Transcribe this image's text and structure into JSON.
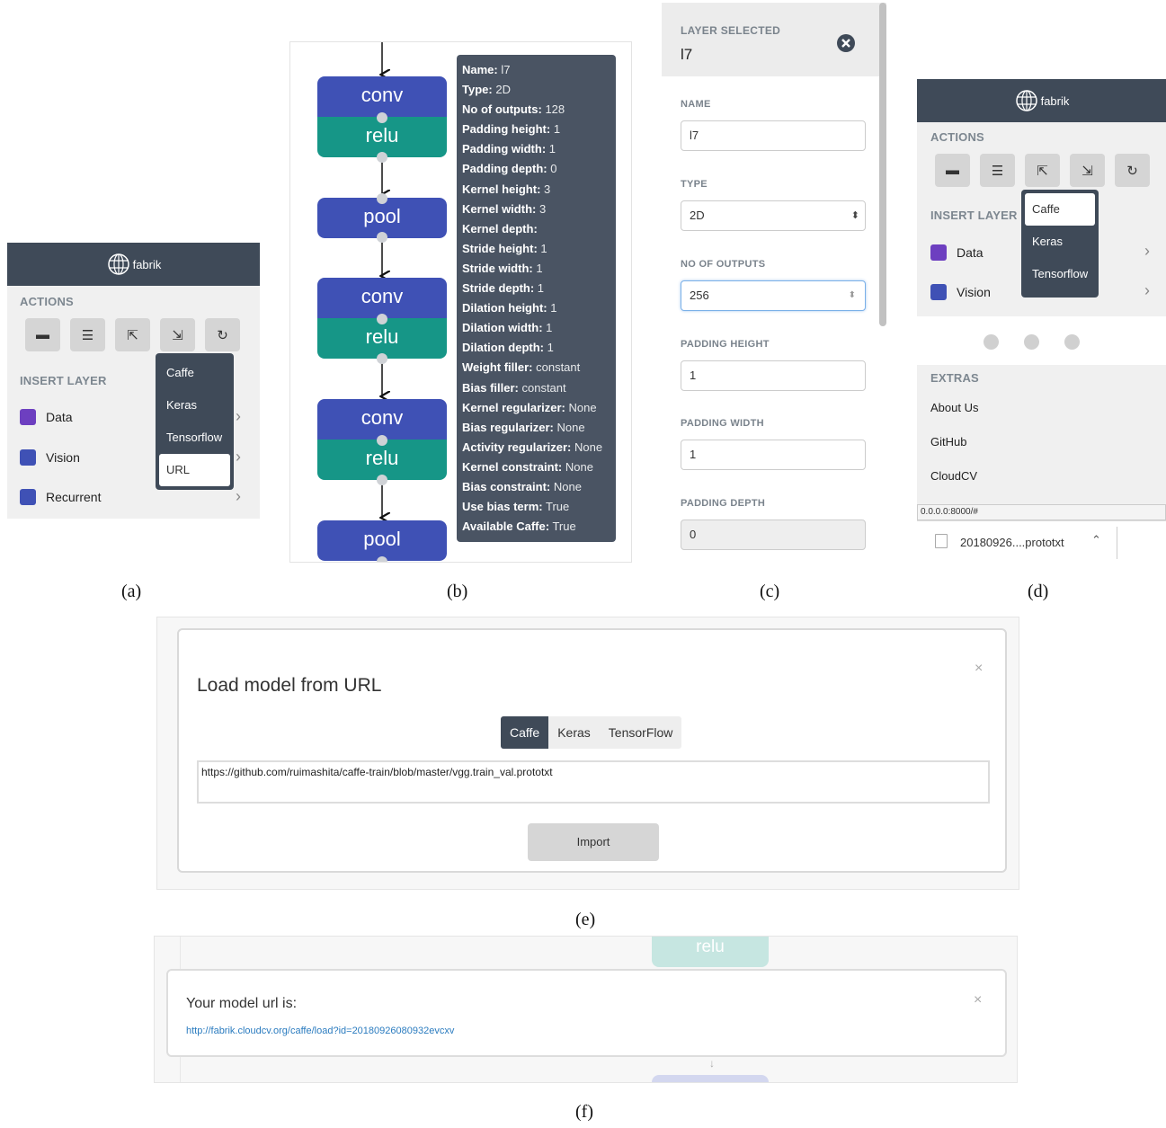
{
  "captions": {
    "a": "(a)",
    "b": "(b)",
    "c": "(c)",
    "d": "(d)",
    "e": "(e)",
    "f": "(f)"
  },
  "sidebar_a": {
    "brand": "fabrik",
    "actions_label": "ACTIONS",
    "action_icons": [
      "open-folder-icon",
      "align-icon",
      "export-icon",
      "import-icon",
      "share-icon"
    ],
    "insert_layer_label": "INSERT LAYER",
    "layers": [
      {
        "label": "Data",
        "color": "#6d3fc0"
      },
      {
        "label": "Vision",
        "color": "#3f51b5"
      },
      {
        "label": "Recurrent",
        "color": "#3f51b5"
      }
    ],
    "dropdown": [
      "Caffe",
      "Keras",
      "Tensorflow",
      "URL"
    ],
    "dropdown_selected": "URL"
  },
  "graph_b": {
    "nodes": [
      {
        "top": "conv",
        "bottom": "relu"
      },
      {
        "top": "pool"
      },
      {
        "top": "conv",
        "bottom": "relu"
      },
      {
        "top": "conv",
        "bottom": "relu"
      },
      {
        "top": "pool"
      }
    ],
    "tooltip": [
      {
        "k": "Name:",
        "v": "l7"
      },
      {
        "k": "Type:",
        "v": "2D"
      },
      {
        "k": "No of outputs:",
        "v": "128"
      },
      {
        "k": "Padding height:",
        "v": "1"
      },
      {
        "k": "Padding width:",
        "v": "1"
      },
      {
        "k": "Padding depth:",
        "v": "0"
      },
      {
        "k": "Kernel height:",
        "v": "3"
      },
      {
        "k": "Kernel width:",
        "v": "3"
      },
      {
        "k": "Kernel depth:",
        "v": ""
      },
      {
        "k": "Stride height:",
        "v": "1"
      },
      {
        "k": "Stride width:",
        "v": "1"
      },
      {
        "k": "Stride depth:",
        "v": "1"
      },
      {
        "k": "Dilation height:",
        "v": "1"
      },
      {
        "k": "Dilation width:",
        "v": "1"
      },
      {
        "k": "Dilation depth:",
        "v": "1"
      },
      {
        "k": "Weight filler:",
        "v": "constant"
      },
      {
        "k": "Bias filler:",
        "v": "constant"
      },
      {
        "k": "Kernel regularizer:",
        "v": "None"
      },
      {
        "k": "Bias regularizer:",
        "v": "None"
      },
      {
        "k": "Activity regularizer:",
        "v": "None"
      },
      {
        "k": "Kernel constraint:",
        "v": "None"
      },
      {
        "k": "Bias constraint:",
        "v": "None"
      },
      {
        "k": "Use bias term:",
        "v": "True"
      },
      {
        "k": "Available Caffe:",
        "v": "True"
      }
    ]
  },
  "layer_panel_c": {
    "header_label": "LAYER SELECTED",
    "layer_name": "l7",
    "fields": [
      {
        "label": "NAME",
        "value": "l7",
        "kind": "text"
      },
      {
        "label": "TYPE",
        "value": "2D",
        "kind": "select"
      },
      {
        "label": "NO OF OUTPUTS",
        "value": "256",
        "kind": "number"
      },
      {
        "label": "PADDING HEIGHT",
        "value": "1",
        "kind": "text"
      },
      {
        "label": "PADDING WIDTH",
        "value": "1",
        "kind": "text"
      },
      {
        "label": "PADDING DEPTH",
        "value": "0",
        "kind": "disabled"
      }
    ]
  },
  "sidebar_d": {
    "brand": "fabrik",
    "actions_label": "ACTIONS",
    "action_icons": [
      "open-folder-icon",
      "align-icon",
      "export-icon",
      "import-icon",
      "share-icon"
    ],
    "insert_layer_label": "INSERT LAYER",
    "layers": [
      {
        "label": "Data",
        "color": "#6d3fc0"
      },
      {
        "label": "Vision",
        "color": "#3f51b5"
      }
    ],
    "dropdown": [
      "Caffe",
      "Keras",
      "Tensorflow"
    ],
    "dropdown_selected": "Caffe",
    "extras_label": "EXTRAS",
    "extras": [
      "About Us",
      "GitHub",
      "CloudCV"
    ],
    "status_url": "0.0.0.0:8000/#",
    "download_file": "20180926....prototxt"
  },
  "modal_e": {
    "title": "Load model from URL",
    "tabs": [
      "Caffe",
      "Keras",
      "TensorFlow"
    ],
    "active_tab": "Caffe",
    "url_value": "https://github.com/ruimashita/caffe-train/blob/master/vgg.train_val.prototxt",
    "import_label": "Import",
    "close": "×"
  },
  "modal_f": {
    "title": "Your model url is:",
    "link": "http://fabrik.cloudcv.org/caffe/load?id=20180926080932evcxv",
    "close": "×",
    "bg_node": "relu",
    "link_color": "#2a7bbf"
  }
}
